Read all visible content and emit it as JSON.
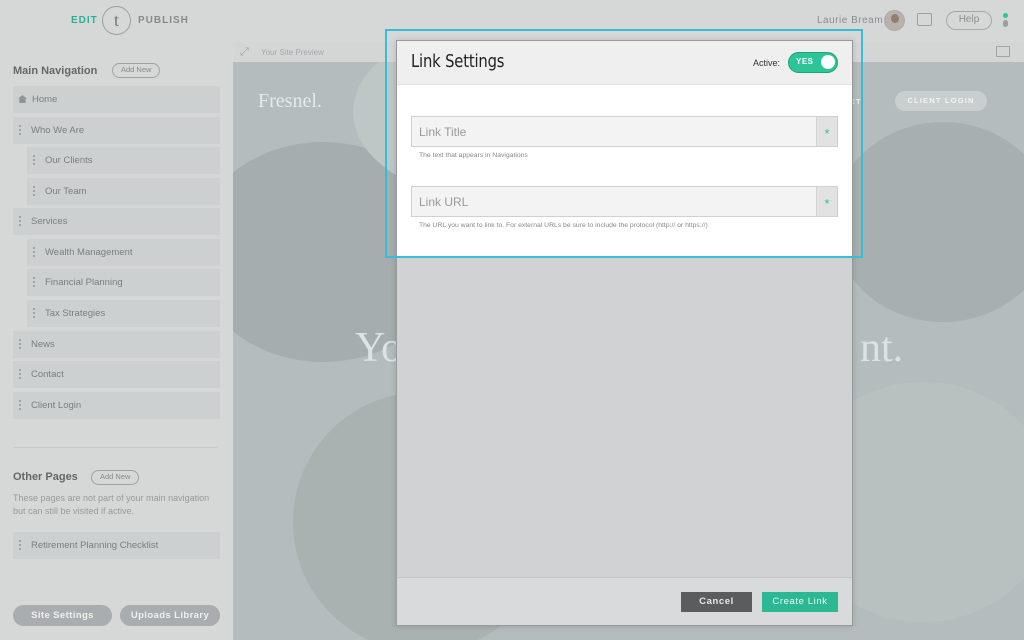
{
  "topbar": {
    "edit_label": "EDIT",
    "logo_letter": "t",
    "publish_label": "PUBLISH",
    "user_name": "Laurie Bream",
    "help_label": "Help"
  },
  "sidebar": {
    "main_nav_title": "Main Navigation",
    "main_nav_add": "Add New",
    "nav_items": [
      {
        "label": "Home"
      },
      {
        "label": "Who We Are"
      },
      {
        "label": "Our Clients"
      },
      {
        "label": "Our Team"
      },
      {
        "label": "Services"
      },
      {
        "label": "Wealth Management"
      },
      {
        "label": "Financial Planning"
      },
      {
        "label": "Tax Strategies"
      },
      {
        "label": "News"
      },
      {
        "label": "Contact"
      },
      {
        "label": "Client Login"
      }
    ],
    "other_pages_title": "Other Pages",
    "other_pages_add": "Add New",
    "other_pages_desc": "These pages are not part of your main navigation but can still be visited if active.",
    "other_items": [
      {
        "label": "Retirement Planning Checklist"
      }
    ],
    "site_settings_label": "Site Settings",
    "uploads_label": "Uploads Library"
  },
  "preview": {
    "label": "Your Site Preview",
    "brand": "Fresnel.",
    "nav_contact": "ACT",
    "client_login": "CLIENT LOGIN",
    "hero_left": "Yo",
    "hero_right": "nt."
  },
  "modal": {
    "title": "Link Settings",
    "active_label": "Active:",
    "toggle_text": "YES",
    "link_title_placeholder": "Link Title",
    "link_title_hint": "The text that appears in Navigations",
    "link_url_placeholder": "Link URL",
    "link_url_hint": "The URL you want to link to. For external URLs be sure to include the protocol (http:// or https://)",
    "required_mark": "*",
    "cancel_label": "Cancel",
    "create_label": "Create Link"
  },
  "colors": {
    "accent": "#2bc597",
    "highlight": "#38bdd6",
    "cancel_bg": "#5a5c5e"
  }
}
